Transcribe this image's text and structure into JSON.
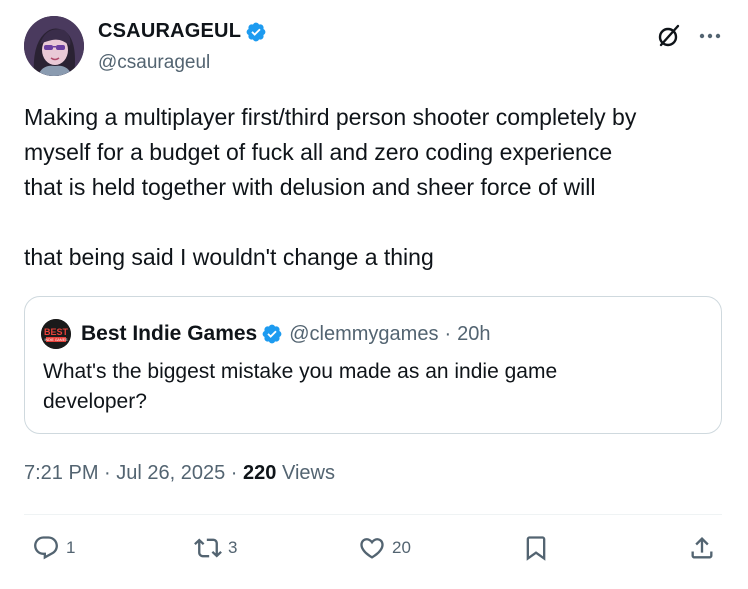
{
  "author": {
    "display_name": "CSAURAGEUL",
    "handle": "@csaurageul",
    "avatar_icon": "avatar-illustration",
    "verified": true
  },
  "header_icons": {
    "grok": "grok-icon",
    "more": "more-icon"
  },
  "tweet": {
    "lines": [
      "Making a multiplayer first/third person shooter completely by",
      "myself for a budget of fuck all and zero coding experience",
      "that is held together with delusion and sheer force of will"
    ],
    "last_line": "that being said I wouldn't change a thing"
  },
  "quote": {
    "display_name": "Best Indie Games",
    "handle": "@clemmygames",
    "separator": "·",
    "time": "20h",
    "logo_text": "BEST",
    "logo_subtext": "INDIE GAMES",
    "text": "What's the biggest mistake you made as an indie game developer?"
  },
  "meta": {
    "time": "7:21 PM",
    "sep1": " · ",
    "date": "Jul 26, 2025",
    "sep2": " · ",
    "views_count": "220",
    "views_label": " Views"
  },
  "actions": {
    "replies": "1",
    "reposts": "3",
    "likes": "20"
  },
  "colors": {
    "verified": "#1d9bf0",
    "secondary_text": "#536471",
    "border": "#cfd9de"
  }
}
